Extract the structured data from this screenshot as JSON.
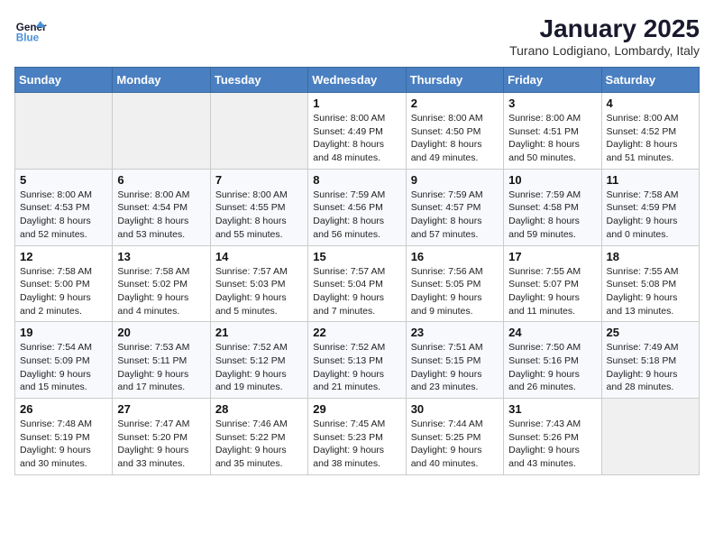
{
  "header": {
    "logo_line1": "General",
    "logo_line2": "Blue",
    "month_title": "January 2025",
    "location": "Turano Lodigiano, Lombardy, Italy"
  },
  "days_of_week": [
    "Sunday",
    "Monday",
    "Tuesday",
    "Wednesday",
    "Thursday",
    "Friday",
    "Saturday"
  ],
  "weeks": [
    [
      {
        "day": "",
        "sunrise": "",
        "sunset": "",
        "daylight": ""
      },
      {
        "day": "",
        "sunrise": "",
        "sunset": "",
        "daylight": ""
      },
      {
        "day": "",
        "sunrise": "",
        "sunset": "",
        "daylight": ""
      },
      {
        "day": "1",
        "sunrise": "8:00 AM",
        "sunset": "4:49 PM",
        "daylight": "8 hours and 48 minutes."
      },
      {
        "day": "2",
        "sunrise": "8:00 AM",
        "sunset": "4:50 PM",
        "daylight": "8 hours and 49 minutes."
      },
      {
        "day": "3",
        "sunrise": "8:00 AM",
        "sunset": "4:51 PM",
        "daylight": "8 hours and 50 minutes."
      },
      {
        "day": "4",
        "sunrise": "8:00 AM",
        "sunset": "4:52 PM",
        "daylight": "8 hours and 51 minutes."
      }
    ],
    [
      {
        "day": "5",
        "sunrise": "8:00 AM",
        "sunset": "4:53 PM",
        "daylight": "8 hours and 52 minutes."
      },
      {
        "day": "6",
        "sunrise": "8:00 AM",
        "sunset": "4:54 PM",
        "daylight": "8 hours and 53 minutes."
      },
      {
        "day": "7",
        "sunrise": "8:00 AM",
        "sunset": "4:55 PM",
        "daylight": "8 hours and 55 minutes."
      },
      {
        "day": "8",
        "sunrise": "7:59 AM",
        "sunset": "4:56 PM",
        "daylight": "8 hours and 56 minutes."
      },
      {
        "day": "9",
        "sunrise": "7:59 AM",
        "sunset": "4:57 PM",
        "daylight": "8 hours and 57 minutes."
      },
      {
        "day": "10",
        "sunrise": "7:59 AM",
        "sunset": "4:58 PM",
        "daylight": "8 hours and 59 minutes."
      },
      {
        "day": "11",
        "sunrise": "7:58 AM",
        "sunset": "4:59 PM",
        "daylight": "9 hours and 0 minutes."
      }
    ],
    [
      {
        "day": "12",
        "sunrise": "7:58 AM",
        "sunset": "5:00 PM",
        "daylight": "9 hours and 2 minutes."
      },
      {
        "day": "13",
        "sunrise": "7:58 AM",
        "sunset": "5:02 PM",
        "daylight": "9 hours and 4 minutes."
      },
      {
        "day": "14",
        "sunrise": "7:57 AM",
        "sunset": "5:03 PM",
        "daylight": "9 hours and 5 minutes."
      },
      {
        "day": "15",
        "sunrise": "7:57 AM",
        "sunset": "5:04 PM",
        "daylight": "9 hours and 7 minutes."
      },
      {
        "day": "16",
        "sunrise": "7:56 AM",
        "sunset": "5:05 PM",
        "daylight": "9 hours and 9 minutes."
      },
      {
        "day": "17",
        "sunrise": "7:55 AM",
        "sunset": "5:07 PM",
        "daylight": "9 hours and 11 minutes."
      },
      {
        "day": "18",
        "sunrise": "7:55 AM",
        "sunset": "5:08 PM",
        "daylight": "9 hours and 13 minutes."
      }
    ],
    [
      {
        "day": "19",
        "sunrise": "7:54 AM",
        "sunset": "5:09 PM",
        "daylight": "9 hours and 15 minutes."
      },
      {
        "day": "20",
        "sunrise": "7:53 AM",
        "sunset": "5:11 PM",
        "daylight": "9 hours and 17 minutes."
      },
      {
        "day": "21",
        "sunrise": "7:52 AM",
        "sunset": "5:12 PM",
        "daylight": "9 hours and 19 minutes."
      },
      {
        "day": "22",
        "sunrise": "7:52 AM",
        "sunset": "5:13 PM",
        "daylight": "9 hours and 21 minutes."
      },
      {
        "day": "23",
        "sunrise": "7:51 AM",
        "sunset": "5:15 PM",
        "daylight": "9 hours and 23 minutes."
      },
      {
        "day": "24",
        "sunrise": "7:50 AM",
        "sunset": "5:16 PM",
        "daylight": "9 hours and 26 minutes."
      },
      {
        "day": "25",
        "sunrise": "7:49 AM",
        "sunset": "5:18 PM",
        "daylight": "9 hours and 28 minutes."
      }
    ],
    [
      {
        "day": "26",
        "sunrise": "7:48 AM",
        "sunset": "5:19 PM",
        "daylight": "9 hours and 30 minutes."
      },
      {
        "day": "27",
        "sunrise": "7:47 AM",
        "sunset": "5:20 PM",
        "daylight": "9 hours and 33 minutes."
      },
      {
        "day": "28",
        "sunrise": "7:46 AM",
        "sunset": "5:22 PM",
        "daylight": "9 hours and 35 minutes."
      },
      {
        "day": "29",
        "sunrise": "7:45 AM",
        "sunset": "5:23 PM",
        "daylight": "9 hours and 38 minutes."
      },
      {
        "day": "30",
        "sunrise": "7:44 AM",
        "sunset": "5:25 PM",
        "daylight": "9 hours and 40 minutes."
      },
      {
        "day": "31",
        "sunrise": "7:43 AM",
        "sunset": "5:26 PM",
        "daylight": "9 hours and 43 minutes."
      },
      {
        "day": "",
        "sunrise": "",
        "sunset": "",
        "daylight": ""
      }
    ]
  ]
}
